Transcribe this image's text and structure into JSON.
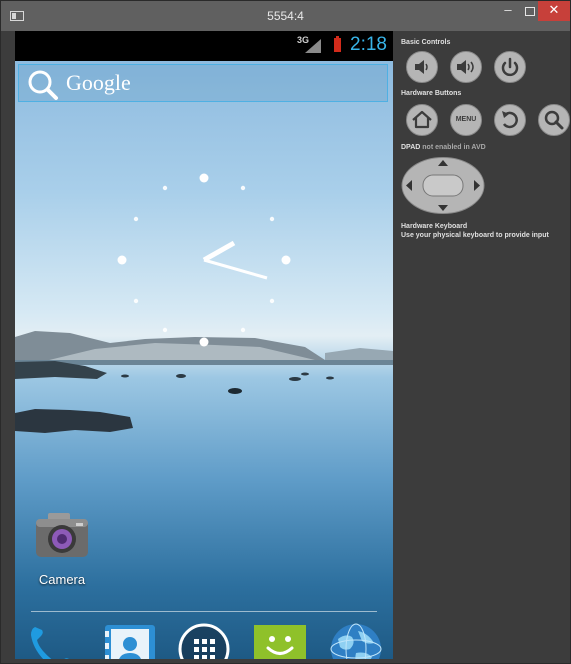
{
  "window": {
    "title": "5554:4"
  },
  "phone": {
    "status_bar": {
      "network": "3G",
      "time": "2:18"
    },
    "search": {
      "label": "Google"
    },
    "apps": [
      {
        "name": "Camera"
      }
    ],
    "dock": [
      {
        "name": "Phone",
        "icon": "phone-icon"
      },
      {
        "name": "Contacts",
        "icon": "contacts-icon"
      },
      {
        "name": "All apps",
        "icon": "app-drawer-icon"
      },
      {
        "name": "Messaging",
        "icon": "messaging-icon"
      },
      {
        "name": "Browser",
        "icon": "browser-icon"
      }
    ]
  },
  "controls": {
    "basic_controls_title": "Basic Controls",
    "hardware_buttons_title": "Hardware Buttons",
    "menu_label": "MENU",
    "dpad_title": "DPAD",
    "dpad_note": "not enabled in AVD",
    "keyboard_title": "Hardware Keyboard",
    "keyboard_note": "Use your physical keyboard to provide input"
  },
  "colors": {
    "accent": "#38b4e8",
    "battery": "#d32b1b",
    "close": "#c7403a",
    "panel": "#3c3c3c",
    "button": "#b5b5b5"
  }
}
